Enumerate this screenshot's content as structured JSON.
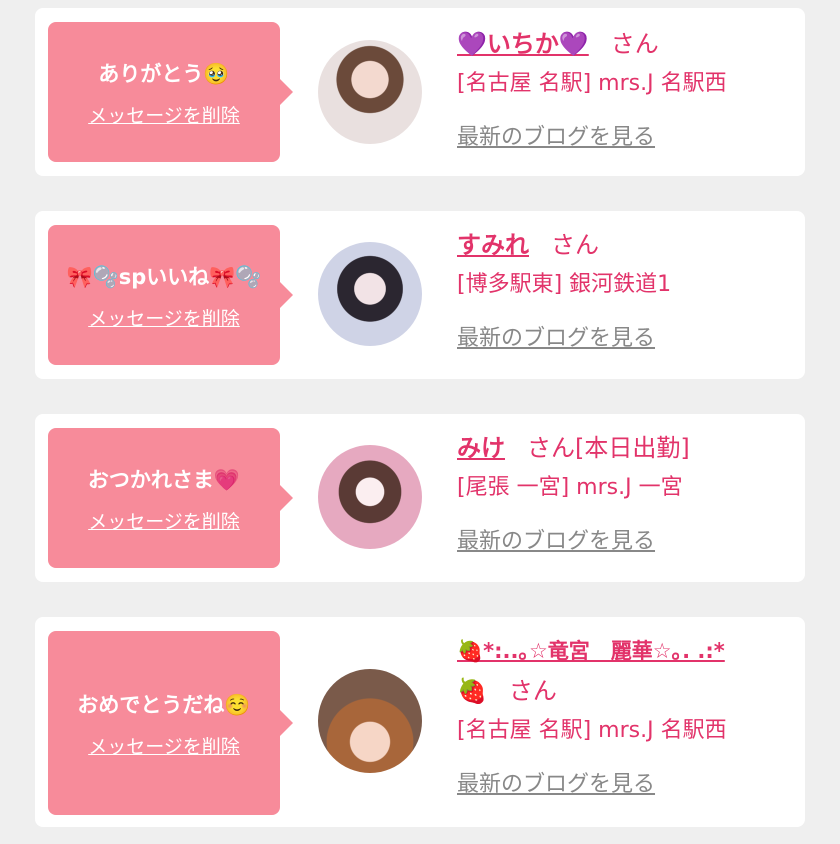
{
  "colors": {
    "background": "#efefef",
    "card": "#ffffff",
    "bubble": "#f78b9a",
    "name": "#e2336a",
    "link_gray": "#888888"
  },
  "messages": [
    {
      "message": "ありがとう🥹",
      "delete_label": "メッセージを削除",
      "avatar_icon": "profile-photo",
      "name": "💜いちか💜",
      "honorific": "さん",
      "status": "",
      "shop": "[名古屋 名駅] mrs.J 名駅西",
      "blog_link": "最新のブログを見る"
    },
    {
      "message": "🎀🫧spいいね🎀🫧",
      "delete_label": "メッセージを削除",
      "avatar_icon": "profile-photo",
      "name": "すみれ",
      "honorific": "さん",
      "status": "",
      "shop": "[博多駅東] 銀河鉄道1",
      "blog_link": "最新のブログを見る"
    },
    {
      "message": "おつかれさま💗",
      "delete_label": "メッセージを削除",
      "avatar_icon": "profile-photo",
      "name": "みけ",
      "honorific": "さん",
      "status": "[本日出勤]",
      "shop": "[尾張 一宮] mrs.J 一宮",
      "blog_link": "最新のブログを見る"
    },
    {
      "message": "おめでとうだね☺️",
      "delete_label": "メッセージを削除",
      "avatar_icon": "profile-photo",
      "name": "🍓*:..｡☆竜宮　麗華☆｡. .:*",
      "name_line2": "🍓",
      "honorific": "さん",
      "status": "",
      "shop": "[名古屋 名駅] mrs.J 名駅西",
      "blog_link": "最新のブログを見る"
    }
  ]
}
